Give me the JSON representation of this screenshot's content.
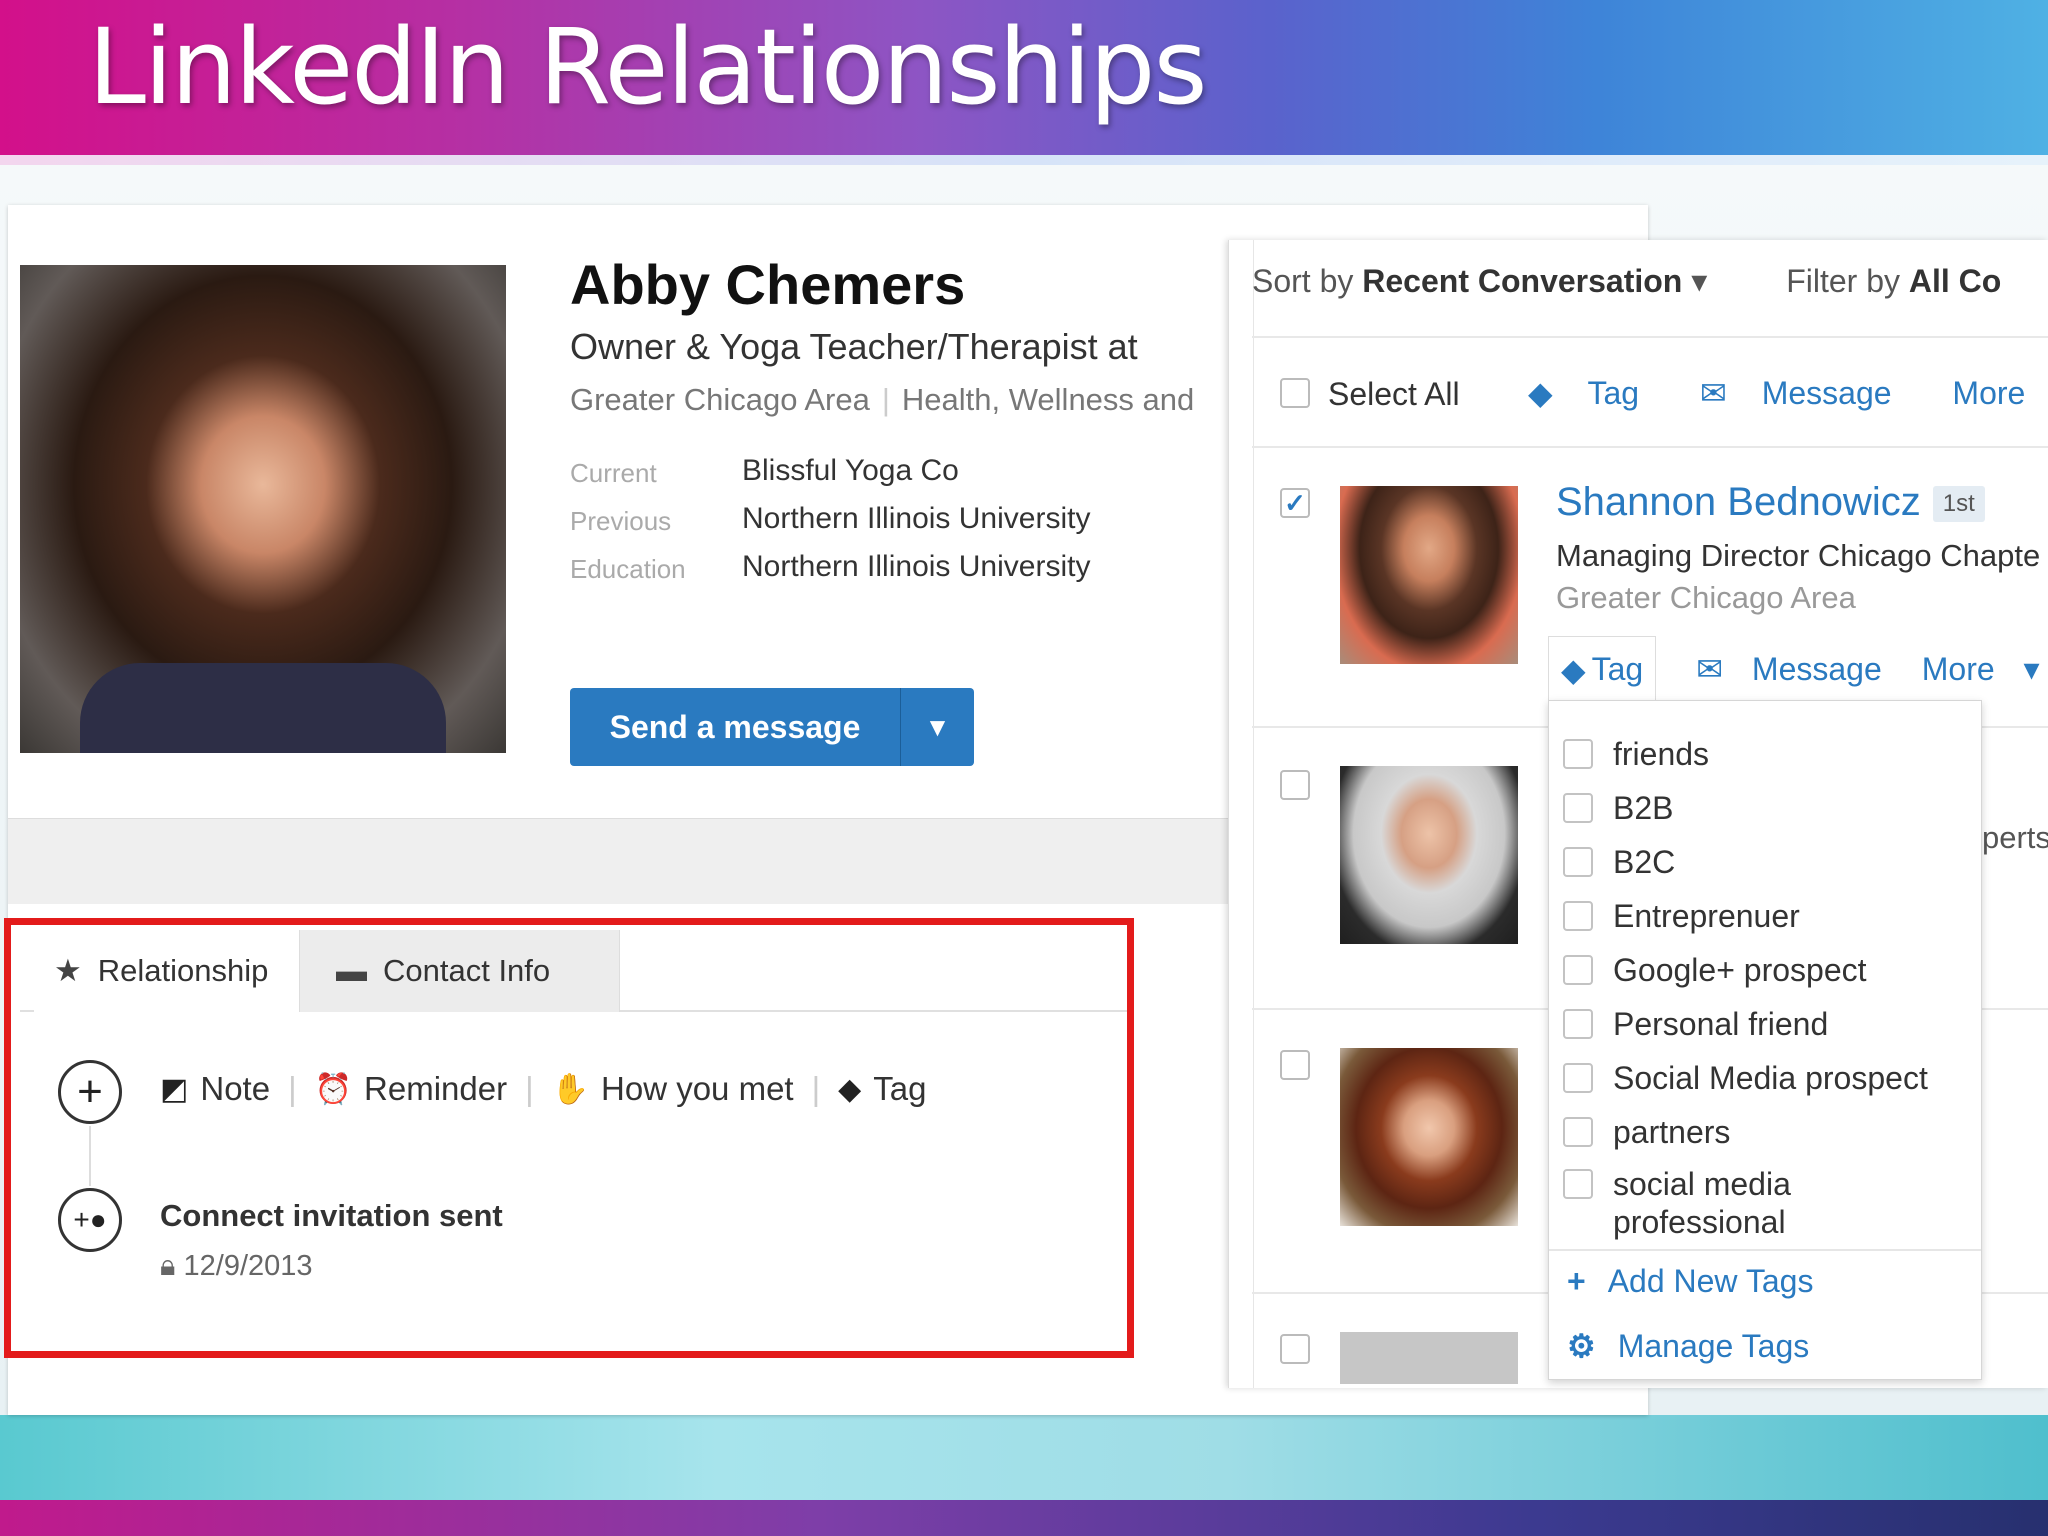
{
  "slide": {
    "title": "LinkedIn Relationships"
  },
  "profile": {
    "name": "Abby Chemers",
    "headline": "Owner & Yoga Teacher/Therapist at",
    "location": "Greater Chicago Area",
    "industry": "Health, Wellness and",
    "fields": [
      {
        "label": "Current",
        "value": "Blissful Yoga Co"
      },
      {
        "label": "Previous",
        "value": "Northern Illinois University"
      },
      {
        "label": "Education",
        "value": "Northern Illinois University"
      }
    ],
    "send_button": "Send a message"
  },
  "relationship": {
    "tabs": [
      "Relationship",
      "Contact Info"
    ],
    "actions": [
      "Note",
      "Reminder",
      "How you met",
      "Tag"
    ],
    "event_title": "Connect invitation sent",
    "event_date": "12/9/2013"
  },
  "contacts": {
    "sort_label": "Sort by",
    "sort_value": "Recent Conversation",
    "filter_label": "Filter by",
    "filter_value": "All Co",
    "select_all": "Select All",
    "bulk_actions": [
      "Tag",
      "Message",
      "More"
    ],
    "first_contact": {
      "name": "Shannon Bednowicz",
      "degree": "1st",
      "title": "Managing Director Chicago Chapte",
      "location": "Greater Chicago Area",
      "actions": [
        "Tag",
        "Message",
        "More"
      ],
      "checked": true
    },
    "partial_text": "perts"
  },
  "tag_dropdown": {
    "tags": [
      "friends",
      "B2B",
      "B2C",
      "Entreprenuer",
      "Google+ prospect",
      "Personal friend",
      "Social Media prospect",
      "partners",
      "social media professional"
    ],
    "add_new": "Add New Tags",
    "manage": "Manage Tags"
  },
  "colors": {
    "link": "#2a7ac0",
    "highlight_border": "#e31b1b",
    "button": "#2a7ac0"
  }
}
